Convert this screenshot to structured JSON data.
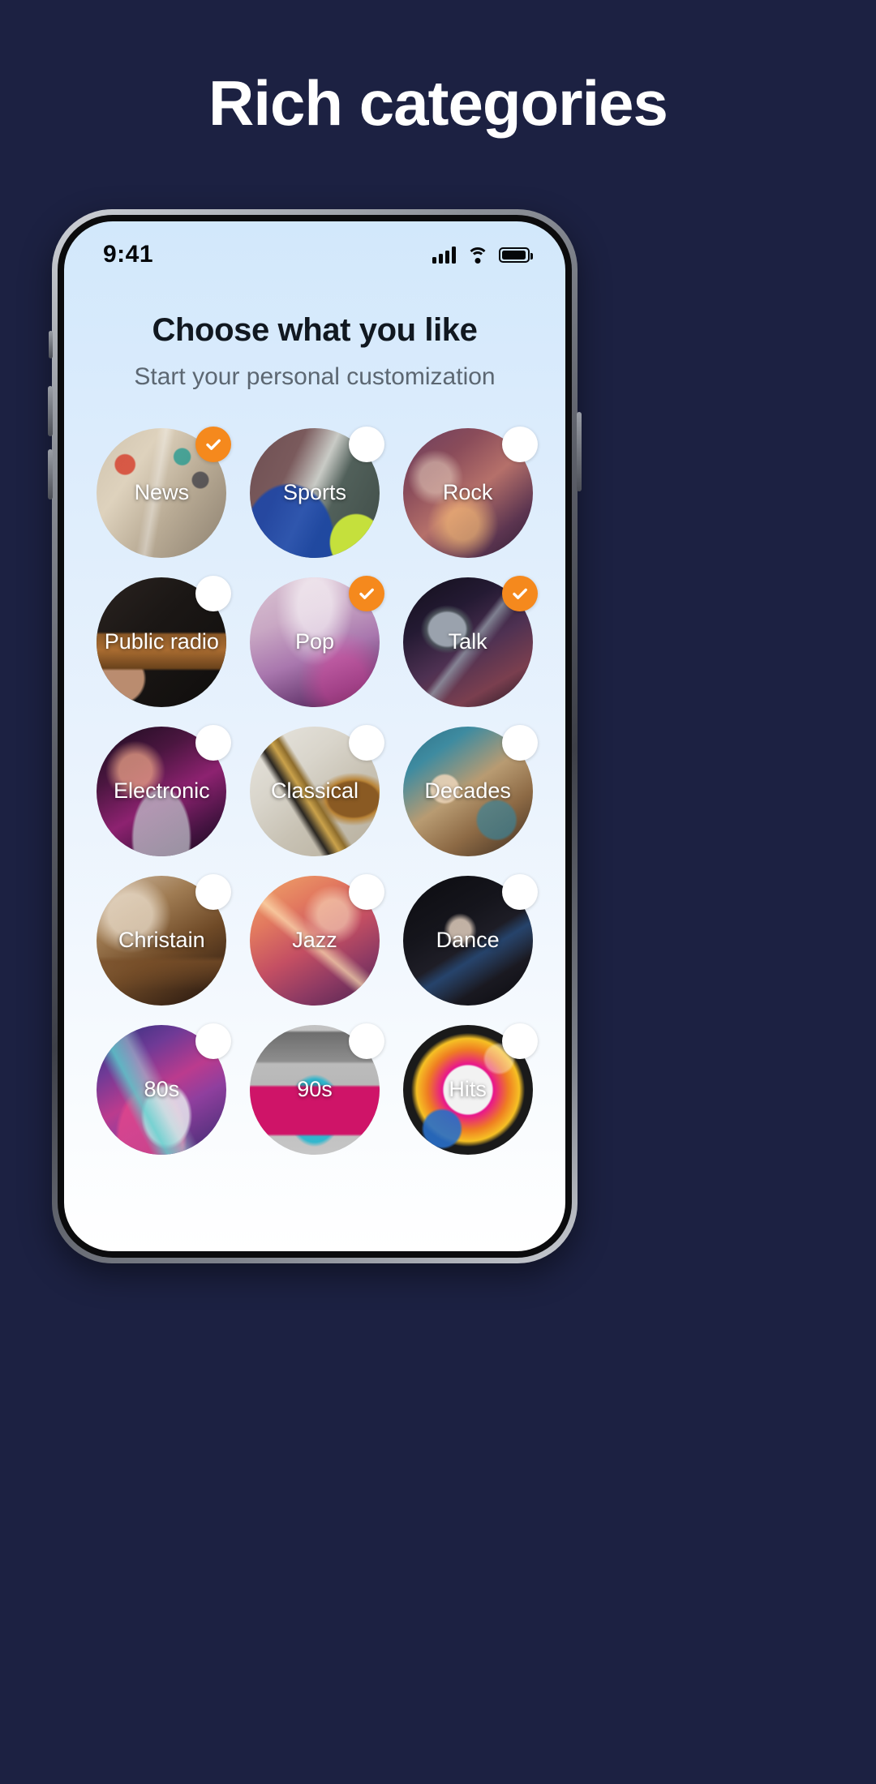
{
  "promo": {
    "title": "Rich categories",
    "background_color": "#1c2142"
  },
  "phone": {
    "status_bar": {
      "time": "9:41",
      "signal_icon": "cellular-signal-icon",
      "wifi_icon": "wifi-icon",
      "battery_icon": "battery-full-icon"
    },
    "screen": {
      "title": "Choose what you like",
      "subtitle": "Start your personal customization",
      "accent_color": "#f5891d",
      "categories": [
        {
          "label": "News",
          "selected": true,
          "art": "art-news"
        },
        {
          "label": "Sports",
          "selected": false,
          "art": "art-sports"
        },
        {
          "label": "Rock",
          "selected": false,
          "art": "art-rock"
        },
        {
          "label": "Public radio",
          "selected": false,
          "art": "art-public"
        },
        {
          "label": "Pop",
          "selected": true,
          "art": "art-pop"
        },
        {
          "label": "Talk",
          "selected": true,
          "art": "art-talk"
        },
        {
          "label": "Electronic",
          "selected": false,
          "art": "art-electronic"
        },
        {
          "label": "Classical",
          "selected": false,
          "art": "art-classical"
        },
        {
          "label": "Decades",
          "selected": false,
          "art": "art-decades"
        },
        {
          "label": "Christain",
          "selected": false,
          "art": "art-christain"
        },
        {
          "label": "Jazz",
          "selected": false,
          "art": "art-jazz"
        },
        {
          "label": "Dance",
          "selected": false,
          "art": "art-dance"
        },
        {
          "label": "80s",
          "selected": false,
          "art": "art-80s"
        },
        {
          "label": "90s",
          "selected": false,
          "art": "art-90s"
        },
        {
          "label": "Hits",
          "selected": false,
          "art": "art-hits"
        }
      ]
    }
  }
}
